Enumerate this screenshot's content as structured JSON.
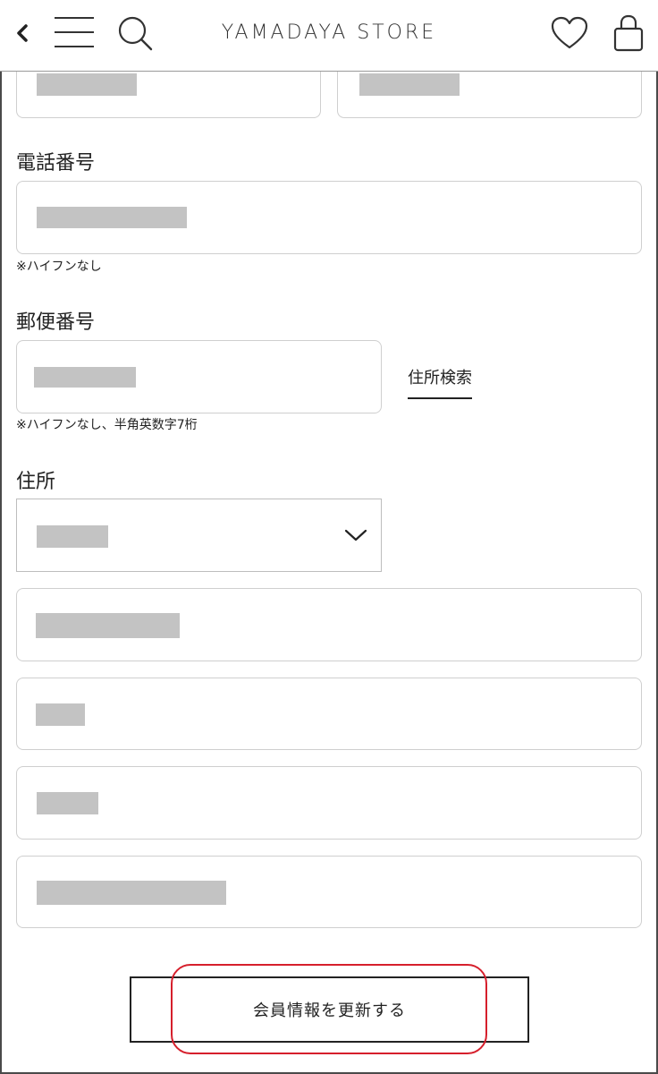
{
  "header": {
    "brand": "YAMADAYA STORE",
    "icons": {
      "back": "chevron-left-icon",
      "menu": "hamburger-menu-icon",
      "search": "search-icon",
      "favorite": "heart-icon",
      "cart": "shopping-bag-icon"
    }
  },
  "form": {
    "phone": {
      "label": "電話番号",
      "note": "※ハイフンなし"
    },
    "postal": {
      "label": "郵便番号",
      "note": "※ハイフンなし、半角英数字7桁",
      "search_link": "住所検索"
    },
    "address": {
      "label": "住所",
      "dropdown_icon": "chevron-down-icon"
    },
    "submit_label": "会員情報を更新する"
  },
  "colors": {
    "accent_highlight": "#d61f2c",
    "mask": "#c3c3c3",
    "border": "#cfcfcf"
  }
}
